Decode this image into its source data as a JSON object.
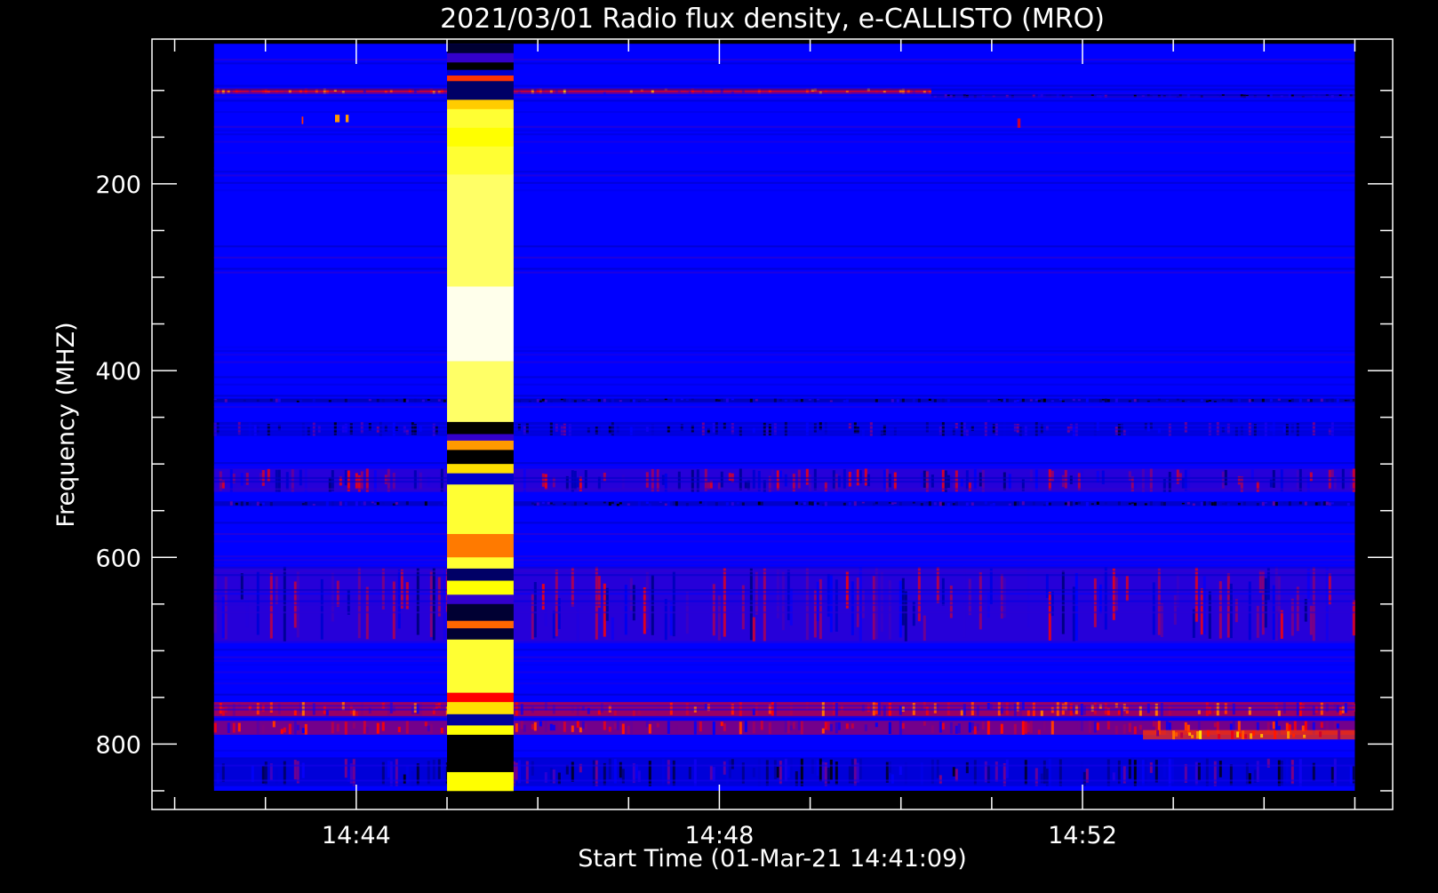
{
  "chart_data": {
    "type": "heatmap",
    "title": "2021/03/01  Radio flux density, e-CALLISTO (MRO)",
    "xlabel": "Start Time (01-Mar-21 14:41:09)",
    "ylabel": "Frequency (MHZ)",
    "x_tick_labels": [
      "14:44",
      "14:48",
      "14:52"
    ],
    "x_tick_values_min": [
      180,
      420,
      660
    ],
    "x_range_min": [
      45,
      865
    ],
    "y_tick_labels": [
      "200",
      "400",
      "600",
      "800"
    ],
    "y_tick_values": [
      200,
      400,
      600,
      800
    ],
    "y_range": [
      45,
      870
    ],
    "y_reversed": true,
    "data_time_range_min": [
      86,
      840
    ],
    "data_freq_range": [
      50,
      850
    ],
    "colormap": [
      "#000000",
      "#0000ff",
      "#ff0000",
      "#ffff00",
      "#ffffff"
    ],
    "background_level": 0.25,
    "freq_bands": [
      {
        "freq": [
          98,
          104
        ],
        "t": [
          86,
          560
        ],
        "level": 0.5
      },
      {
        "freq": [
          104,
          108
        ],
        "t": [
          560,
          840
        ],
        "level": 0.18
      },
      {
        "freq": [
          430,
          434
        ],
        "t": [
          86,
          840
        ],
        "level": 0.16
      },
      {
        "freq": [
          455,
          470
        ],
        "t": [
          86,
          840
        ],
        "level": 0.2
      },
      {
        "freq": [
          505,
          530
        ],
        "t": [
          86,
          840
        ],
        "level": 0.3
      },
      {
        "freq": [
          540,
          545
        ],
        "t": [
          86,
          840
        ],
        "level": 0.18
      },
      {
        "freq": [
          610,
          690
        ],
        "t": [
          86,
          840
        ],
        "level": 0.3
      },
      {
        "freq": [
          755,
          770
        ],
        "t": [
          86,
          840
        ],
        "level": 0.45
      },
      {
        "freq": [
          775,
          790
        ],
        "t": [
          86,
          840
        ],
        "level": 0.4
      },
      {
        "freq": [
          785,
          795
        ],
        "t": [
          700,
          840
        ],
        "level": 0.55
      },
      {
        "freq": [
          815,
          845
        ],
        "t": [
          86,
          840
        ],
        "level": 0.2
      }
    ],
    "burst_column": {
      "t": [
        240,
        284
      ],
      "segments": [
        {
          "freq": [
            50,
            60
          ],
          "level": 0.05
        },
        {
          "freq": [
            60,
            70
          ],
          "level": 0.3
        },
        {
          "freq": [
            70,
            78
          ],
          "level": 0.0
        },
        {
          "freq": [
            78,
            84
          ],
          "level": 0.2
        },
        {
          "freq": [
            84,
            90
          ],
          "level": 0.55
        },
        {
          "freq": [
            90,
            110
          ],
          "level": 0.1
        },
        {
          "freq": [
            110,
            120
          ],
          "level": 0.7
        },
        {
          "freq": [
            120,
            140
          ],
          "level": 0.8
        },
        {
          "freq": [
            140,
            160
          ],
          "level": 0.75
        },
        {
          "freq": [
            160,
            190
          ],
          "level": 0.8
        },
        {
          "freq": [
            190,
            310
          ],
          "level": 0.85
        },
        {
          "freq": [
            310,
            390
          ],
          "level": 0.98
        },
        {
          "freq": [
            390,
            455
          ],
          "level": 0.85
        },
        {
          "freq": [
            455,
            468
          ],
          "level": 0.0
        },
        {
          "freq": [
            468,
            475
          ],
          "level": 0.3
        },
        {
          "freq": [
            475,
            485
          ],
          "level": 0.65
        },
        {
          "freq": [
            485,
            500
          ],
          "level": 0.0
        },
        {
          "freq": [
            500,
            510
          ],
          "level": 0.72
        },
        {
          "freq": [
            510,
            522
          ],
          "level": 0.2
        },
        {
          "freq": [
            522,
            575
          ],
          "level": 0.8
        },
        {
          "freq": [
            575,
            600
          ],
          "level": 0.62
        },
        {
          "freq": [
            600,
            612
          ],
          "level": 0.8
        },
        {
          "freq": [
            612,
            625
          ],
          "level": 0.1
        },
        {
          "freq": [
            625,
            640
          ],
          "level": 0.75
        },
        {
          "freq": [
            640,
            650
          ],
          "level": 0.3
        },
        {
          "freq": [
            650,
            668
          ],
          "level": 0.05
        },
        {
          "freq": [
            668,
            676
          ],
          "level": 0.6
        },
        {
          "freq": [
            676,
            688
          ],
          "level": 0.05
        },
        {
          "freq": [
            688,
            745
          ],
          "level": 0.8
        },
        {
          "freq": [
            745,
            755
          ],
          "level": 0.5
        },
        {
          "freq": [
            755,
            768
          ],
          "level": 0.72
        },
        {
          "freq": [
            768,
            780
          ],
          "level": 0.15
        },
        {
          "freq": [
            780,
            790
          ],
          "level": 0.75
        },
        {
          "freq": [
            790,
            830
          ],
          "level": 0.0
        },
        {
          "freq": [
            830,
            850
          ],
          "level": 0.75
        }
      ]
    },
    "spots": [
      {
        "t": [
          166,
          169
        ],
        "freq": [
          126,
          134
        ],
        "level": 0.65
      },
      {
        "t": [
          173,
          175
        ],
        "freq": [
          126,
          134
        ],
        "level": 0.65
      },
      {
        "t": [
          144,
          145
        ],
        "freq": [
          128,
          136
        ],
        "level": 0.55
      },
      {
        "t": [
          617,
          619
        ],
        "freq": [
          130,
          140
        ],
        "level": 0.45
      }
    ]
  }
}
